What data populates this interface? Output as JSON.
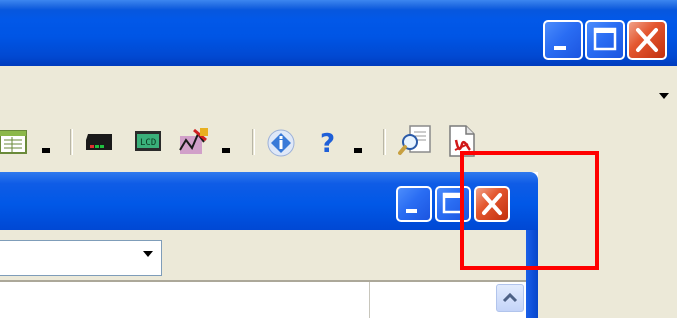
{
  "outer_window": {
    "caption_buttons": [
      "minimize",
      "maximize",
      "close"
    ]
  },
  "menu_bar": {
    "overflow_icon": "chevron-down-icon"
  },
  "toolbar": {
    "icons": [
      "spreadsheet-icon",
      "dropdown-arrow-icon",
      "device-icon",
      "lcd-icon",
      "signal-icon",
      "dropdown-arrow-icon",
      "info-icon",
      "help-icon",
      "dropdown-arrow-icon",
      "search-document-icon",
      "pdf-document-icon"
    ]
  },
  "inner_window": {
    "caption_buttons": [
      "minimize",
      "maximize",
      "close"
    ],
    "combo_value": "",
    "scroll_icon": "scroll-up-icon"
  },
  "colors": {
    "title_bar_blue": "#0055e5",
    "close_red": "#e4572f",
    "face": "#ece9d8",
    "highlight": "#ff0000"
  }
}
